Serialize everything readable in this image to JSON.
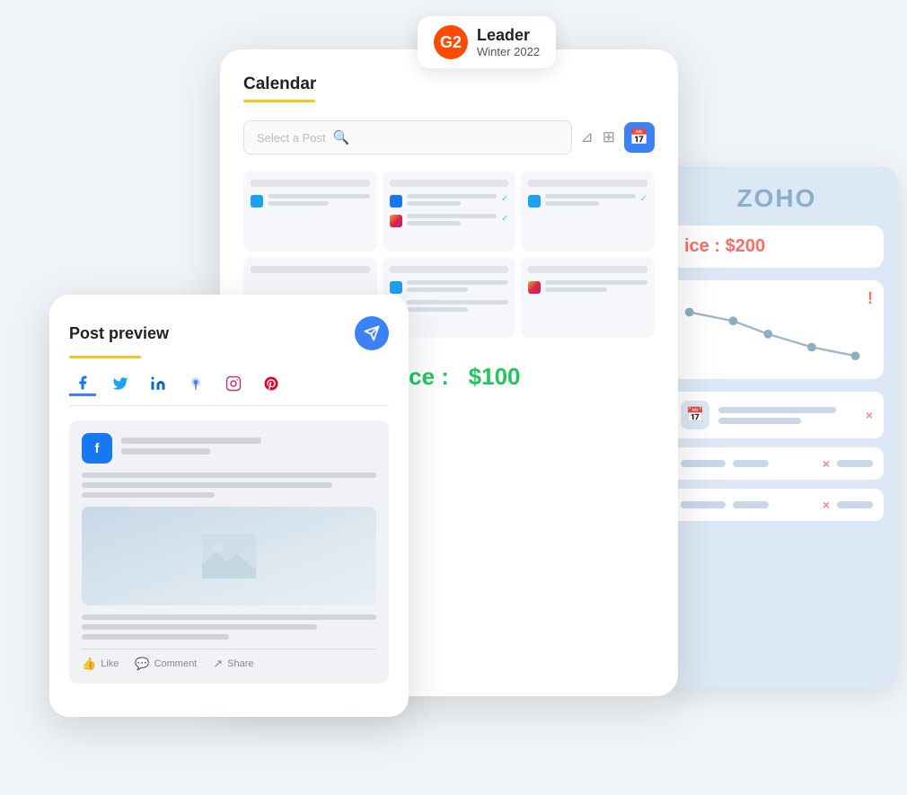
{
  "g2_badge": {
    "logo_text": "G2",
    "leader_label": "Leader",
    "winter_label": "Winter 2022"
  },
  "zoho_card": {
    "logo": "ZOHO",
    "price_label": "ice :",
    "price_value": "$200",
    "x_label": "×",
    "rows": [
      {
        "has_icon": true,
        "has_x": true
      },
      {
        "has_icon": false,
        "has_x": true
      }
    ]
  },
  "calendar_card": {
    "title": "Calendar",
    "search_placeholder": "Select a Post",
    "price_label": "Price :",
    "price_value": "$100"
  },
  "preview_card": {
    "title": "Post preview",
    "tabs": [
      {
        "name": "facebook",
        "symbol": "f",
        "active": true
      },
      {
        "name": "twitter",
        "symbol": "t"
      },
      {
        "name": "linkedin",
        "symbol": "in"
      },
      {
        "name": "google-maps",
        "symbol": "g"
      },
      {
        "name": "instagram",
        "symbol": "ig"
      },
      {
        "name": "pinterest",
        "symbol": "p"
      }
    ],
    "fb_actions": [
      {
        "label": "Like"
      },
      {
        "label": "Comment"
      },
      {
        "label": "Share"
      }
    ]
  }
}
